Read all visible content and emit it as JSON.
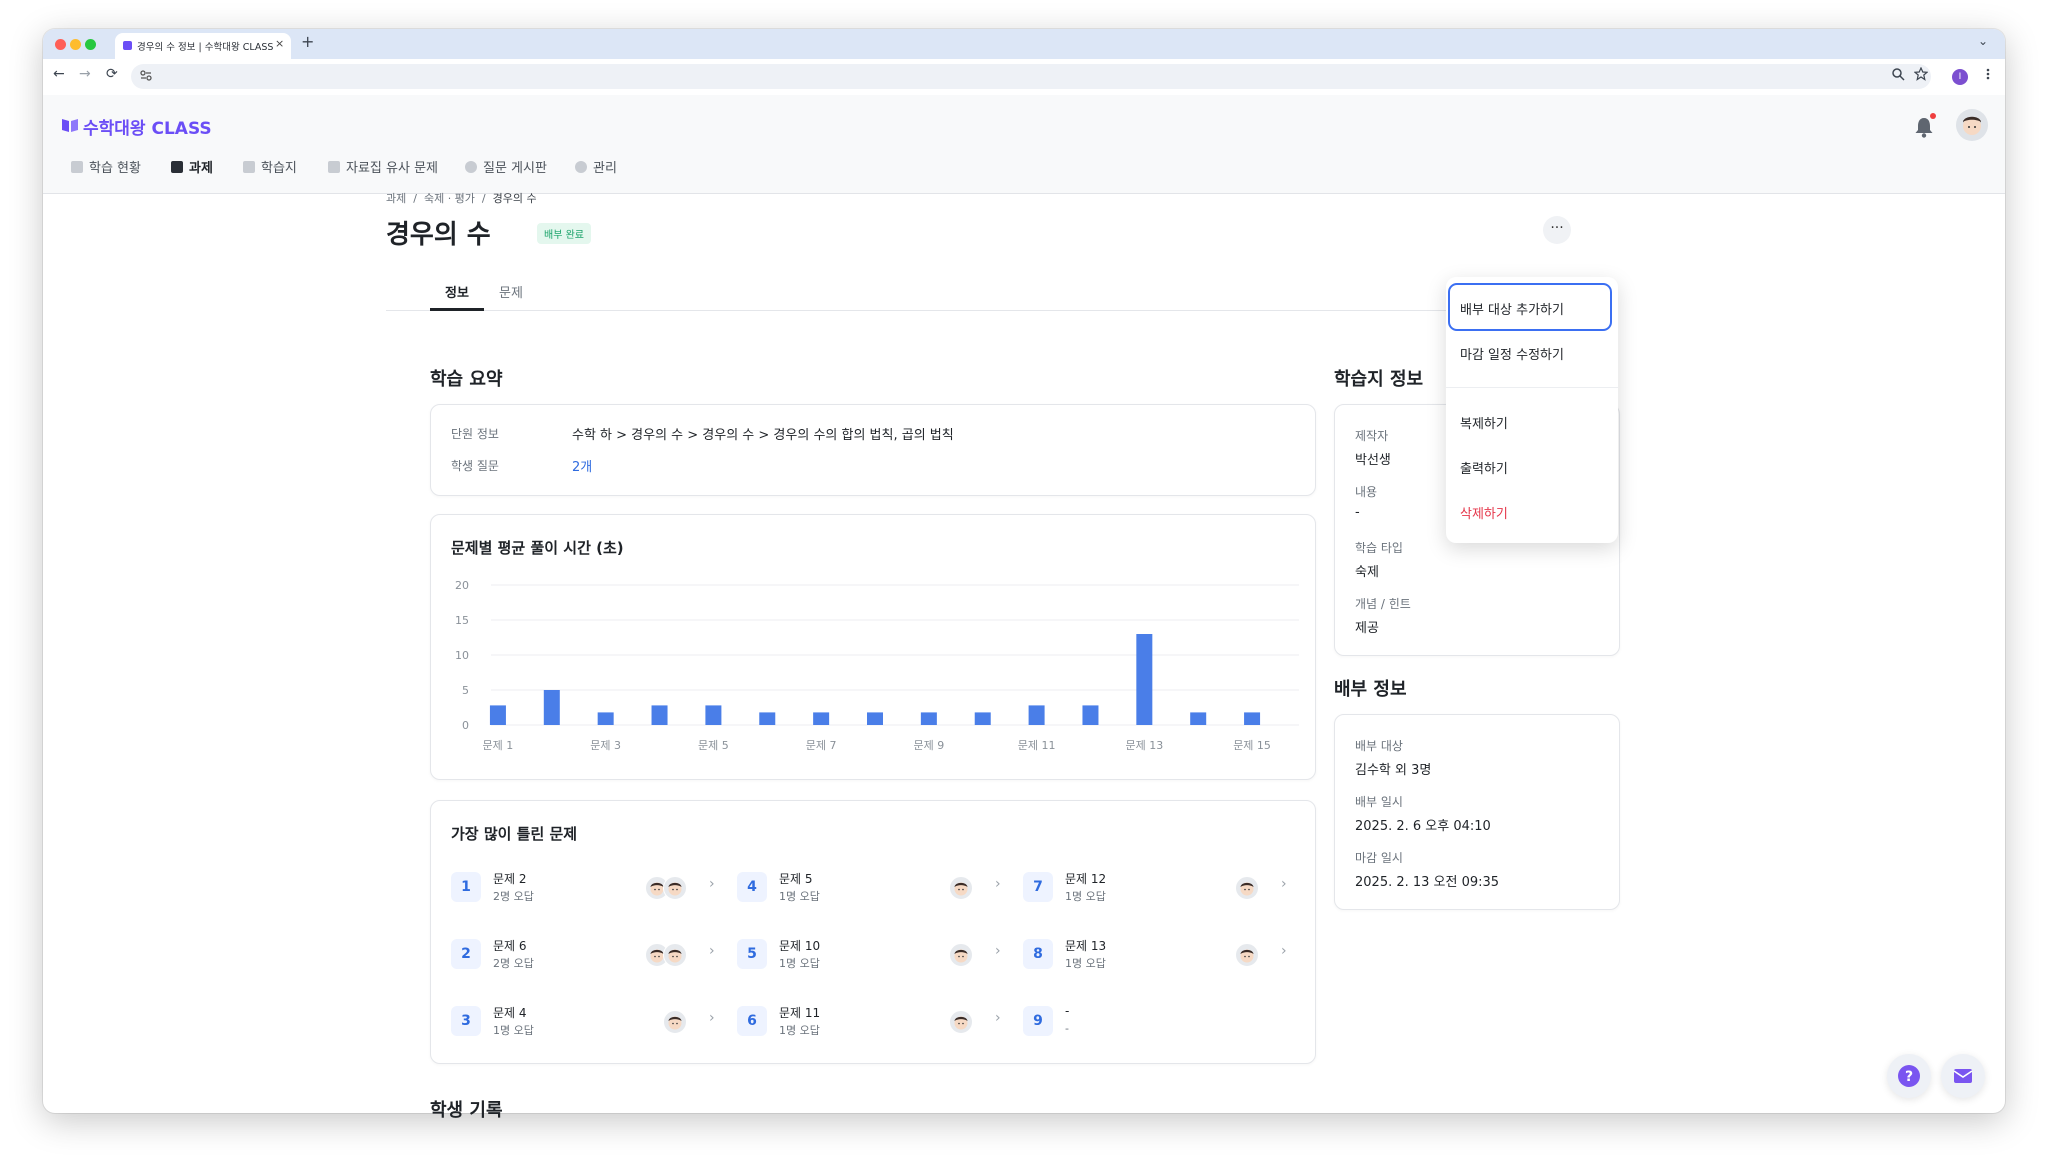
{
  "browser": {
    "tab_title": "경우의 수 정보 | 수학대왕 CLASS",
    "tab_close": "×",
    "new_tab": "+",
    "tabs_dropdown": "⌄",
    "back": "←",
    "forward": "→",
    "reload": "⟳",
    "profile_initial": "I"
  },
  "app": {
    "logo_text": "수학대왕 CLASS",
    "nav": [
      {
        "label": "학습 현황"
      },
      {
        "label": "과제"
      },
      {
        "label": "학습지"
      },
      {
        "label": "자료집 유사 문제"
      },
      {
        "label": "질문 게시판"
      },
      {
        "label": "관리"
      }
    ]
  },
  "page": {
    "breadcrumb": [
      "과제",
      "숙제 · 평가",
      "경우의 수"
    ],
    "title": "경우의 수",
    "status_badge": "배부 완료",
    "more_label": "···",
    "tabs": [
      {
        "label": "정보"
      },
      {
        "label": "문제"
      }
    ]
  },
  "summary": {
    "title": "학습 요약",
    "unit_label": "단원 정보",
    "unit_value": "수학 하 > 경우의 수 > 경우의 수 > 경우의 수의 합의 법칙, 곱의 법칙",
    "questions_label": "학생 질문",
    "questions_value": "2개"
  },
  "chart_data": {
    "type": "bar",
    "title": "문제별 평균 풀이 시간 (초)",
    "categories": [
      "문제 1",
      "문제 2",
      "문제 3",
      "문제 4",
      "문제 5",
      "문제 6",
      "문제 7",
      "문제 8",
      "문제 9",
      "문제 10",
      "문제 11",
      "문제 12",
      "문제 13",
      "문제 14",
      "문제 15"
    ],
    "x_tick_labels": [
      "문제 1",
      "문제 3",
      "문제 5",
      "문제 7",
      "문제 9",
      "문제 11",
      "문제 13",
      "문제 15"
    ],
    "values": [
      2.8,
      5.0,
      1.8,
      2.8,
      2.8,
      1.8,
      1.8,
      1.8,
      1.8,
      1.8,
      2.8,
      2.8,
      13.0,
      1.8,
      1.8
    ],
    "ylim": [
      0,
      20
    ],
    "yticks": [
      0,
      5,
      10,
      15,
      20
    ],
    "color": "#4a7ee8",
    "grid": true
  },
  "most_wrong": {
    "title": "가장 많이 틀린 문제",
    "items": [
      {
        "num": "1",
        "name": "문제 2",
        "count": "2명 오답",
        "faces": 2
      },
      {
        "num": "4",
        "name": "문제 5",
        "count": "1명 오답",
        "faces": 1
      },
      {
        "num": "7",
        "name": "문제 12",
        "count": "1명 오답",
        "faces": 1
      },
      {
        "num": "2",
        "name": "문제 6",
        "count": "2명 오답",
        "faces": 2
      },
      {
        "num": "5",
        "name": "문제 10",
        "count": "1명 오답",
        "faces": 1
      },
      {
        "num": "8",
        "name": "문제 13",
        "count": "1명 오답",
        "faces": 1
      },
      {
        "num": "3",
        "name": "문제 4",
        "count": "1명 오답",
        "faces": 1
      },
      {
        "num": "6",
        "name": "문제 11",
        "count": "1명 오답",
        "faces": 1
      },
      {
        "num": "9",
        "name": "-",
        "count": "-",
        "faces": 0
      }
    ]
  },
  "student_record_title": "학생 기록",
  "worksheet": {
    "title": "학습지 정보",
    "author_label": "제작자",
    "author_value": "박선생",
    "content_label": "내용",
    "content_value": "-",
    "type_label": "학습 타입",
    "type_value": "숙제",
    "hint_label": "개념 / 힌트",
    "hint_value": "제공"
  },
  "distribution": {
    "title": "배부 정보",
    "target_label": "배부 대상",
    "target_value": "김수학 외 3명",
    "date_label": "배부 일시",
    "date_value": "2025. 2. 6 오후 04:10",
    "due_label": "마감 일시",
    "due_value": "2025. 2. 13 오전 09:35"
  },
  "menu": {
    "items": [
      {
        "label": "배부 대상 추가하기"
      },
      {
        "label": "마감 일정 수정하기"
      },
      {
        "label": "복제하기"
      },
      {
        "label": "출력하기"
      },
      {
        "label": "삭제하기"
      }
    ]
  },
  "colors": {
    "brand": "#6b4ef6",
    "accent": "#2f6bdf",
    "danger": "#e5364a",
    "success": "#1aa36a"
  }
}
